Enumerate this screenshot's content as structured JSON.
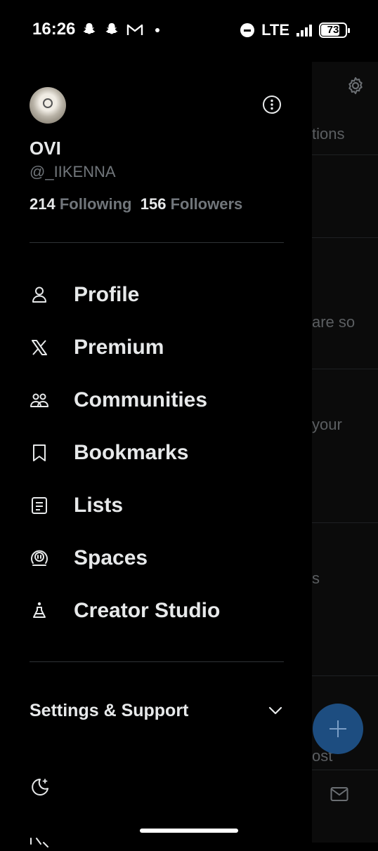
{
  "status_bar": {
    "time": "16:26",
    "network": "LTE",
    "battery": "73",
    "left_icons": [
      "snapchat-icon",
      "snapchat-icon",
      "gmail-icon",
      "dot-icon"
    ]
  },
  "profile": {
    "display_name": "OVI",
    "handle": "@_IIKENNA",
    "following_count": "214",
    "following_label": "Following",
    "followers_count": "156",
    "followers_label": "Followers"
  },
  "menu": [
    {
      "label": "Profile",
      "icon": "person-icon"
    },
    {
      "label": "Premium",
      "icon": "x-logo-icon"
    },
    {
      "label": "Communities",
      "icon": "communities-icon"
    },
    {
      "label": "Bookmarks",
      "icon": "bookmark-icon"
    },
    {
      "label": "Lists",
      "icon": "list-icon"
    },
    {
      "label": "Spaces",
      "icon": "spaces-icon"
    },
    {
      "label": "Creator Studio",
      "icon": "flask-icon"
    }
  ],
  "settings": {
    "label": "Settings & Support"
  },
  "background": {
    "snippets": [
      "tions",
      "are so",
      "your",
      "s",
      "ost"
    ]
  },
  "colors": {
    "background": "#000000",
    "primary_text": "#e7e9ea",
    "secondary_text": "#71767b",
    "divider": "#2f3336",
    "fab": "#1d4d80"
  }
}
